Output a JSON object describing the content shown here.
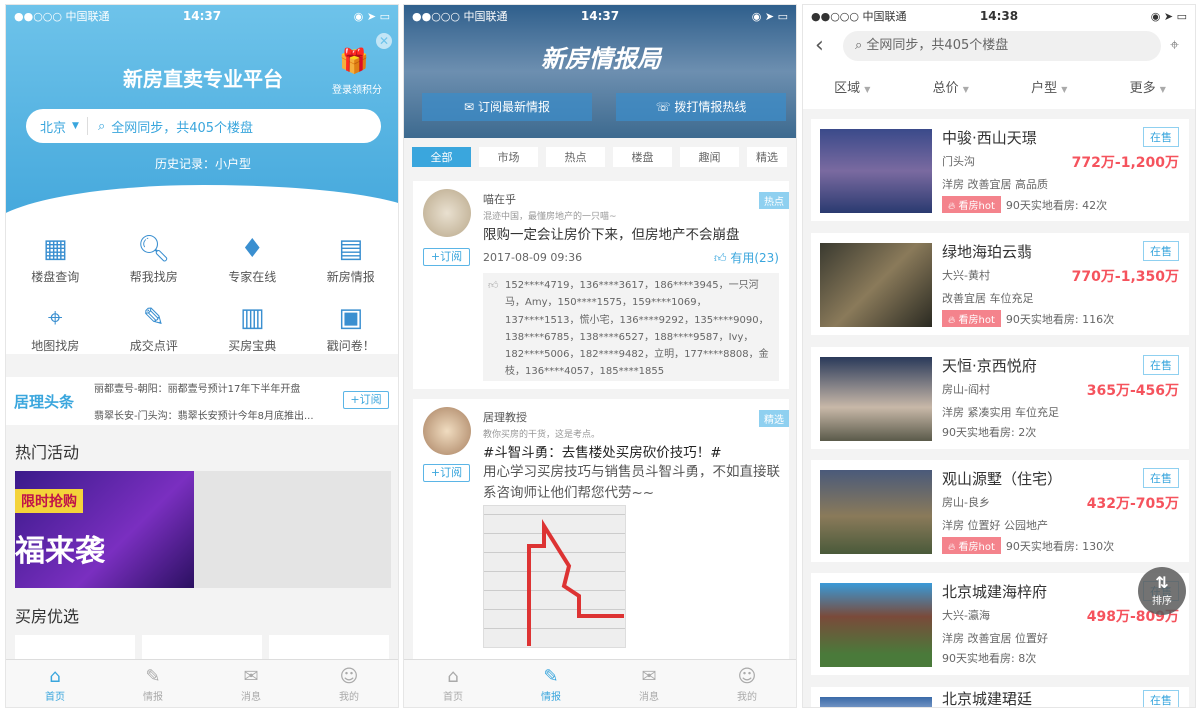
{
  "status_bars": [
    {
      "carrier": "●●○○○ 中国联通",
      "time": "14:37"
    },
    {
      "carrier": "●●○○○ 中国联通",
      "time": "14:37"
    },
    {
      "carrier": "●●○○○ 中国联通",
      "time": "14:38"
    }
  ],
  "home": {
    "title": "新房直卖专业平台",
    "gift_label": "登录领积分",
    "city": "北京",
    "search_placeholder": "全网同步，共405个楼盘",
    "history": "历史记录：小户型",
    "grid": [
      {
        "label": "楼盘查询",
        "icon": "building-icon"
      },
      {
        "label": "帮我找房",
        "icon": "magnifier-icon"
      },
      {
        "label": "专家在线",
        "icon": "tie-icon"
      },
      {
        "label": "新房情报",
        "icon": "document-icon"
      },
      {
        "label": "地图找房",
        "icon": "map-icon"
      },
      {
        "label": "成交点评",
        "icon": "edit-icon"
      },
      {
        "label": "买房宝典",
        "icon": "book-icon"
      },
      {
        "label": "戳问卷！",
        "icon": "clipboard-icon"
      }
    ],
    "headline_brand": "居理头条",
    "headlines": [
      "丽都壹号-朝阳：丽都壹号预计17年下半年开盘",
      "翡翠长安-门头沟：翡翠长安预计今年8月底推出..."
    ],
    "subscribe": "+订阅",
    "hot_title": "热门活动",
    "banner_text1": "限时抢购",
    "banner_text2": "福来袭",
    "picks_title": "买房优选"
  },
  "news": {
    "title": "新房情报局",
    "btn_subscribe": "订阅最新情报",
    "btn_hotline": "拨打情报热线",
    "filters": [
      "全部",
      "市场",
      "热点",
      "楼盘",
      "趣闻",
      "精选"
    ],
    "posts": [
      {
        "author": "喵在乎",
        "bio": "混迹中国，最懂房地产的一只喵~",
        "tag": "热点",
        "title": "限购一定会让房价下来，但房地产不会崩盘",
        "date": "2017-08-09 09:36",
        "useful": "有用(23)",
        "likers": "152****4719，136****3617，186****3945，一只河马，Amy，150****1575，159****1069，137****1513，慌小宅，136****9292，135****9090，138****6785，138****6527，188****9587，Ivy，182****5006，182****9482，立明，177****8808，金枝，136****4057，185****1855",
        "subscribe": "+订阅"
      },
      {
        "author": "居理教授",
        "bio": "教你买房的干货，这是考点。",
        "tag": "精选",
        "title": "#斗智斗勇：去售楼处买房砍价技巧！#",
        "body": "用心学习买房技巧与销售员斗智斗勇，不如直接联系咨询师让他们帮您代劳~~",
        "subscribe": "+订阅"
      }
    ]
  },
  "listing": {
    "search_placeholder": "全网同步，共405个楼盘",
    "filters": [
      "区域",
      "总价",
      "户型",
      "更多"
    ],
    "sort_label": "排序",
    "items": [
      {
        "name": "中骏·西山天璟",
        "loc": "门头沟",
        "price": "772万-1,200万",
        "tags": "洋房 改善宜居 高品质",
        "hot": "看房hot",
        "visits": "90天实地看房: 42次",
        "status": "在售"
      },
      {
        "name": "绿地海珀云翡",
        "loc": "大兴-黄村",
        "price": "770万-1,350万",
        "tags": "改善宜居 车位充足",
        "hot": "看房hot",
        "visits": "90天实地看房: 116次",
        "status": "在售"
      },
      {
        "name": "天恒·京西悦府",
        "loc": "房山-阎村",
        "price": "365万-456万",
        "tags": "洋房 紧凑实用 车位充足",
        "visits": "90天实地看房: 2次",
        "status": "在售"
      },
      {
        "name": "观山源墅（住宅）",
        "loc": "房山-良乡",
        "price": "432万-705万",
        "tags": "洋房 位置好 公园地产",
        "hot": "看房hot",
        "visits": "90天实地看房: 130次",
        "status": "在售"
      },
      {
        "name": "北京城建海梓府",
        "loc": "大兴-瀛海",
        "price": "498万-809万",
        "tags": "洋房 改善宜居 位置好",
        "visits": "90天实地看房: 8次",
        "status": "在售"
      },
      {
        "name": "北京城建珺廷",
        "status": "在售"
      }
    ]
  },
  "tabbar": [
    {
      "label": "首页"
    },
    {
      "label": "情报"
    },
    {
      "label": "消息"
    },
    {
      "label": "我的"
    }
  ]
}
